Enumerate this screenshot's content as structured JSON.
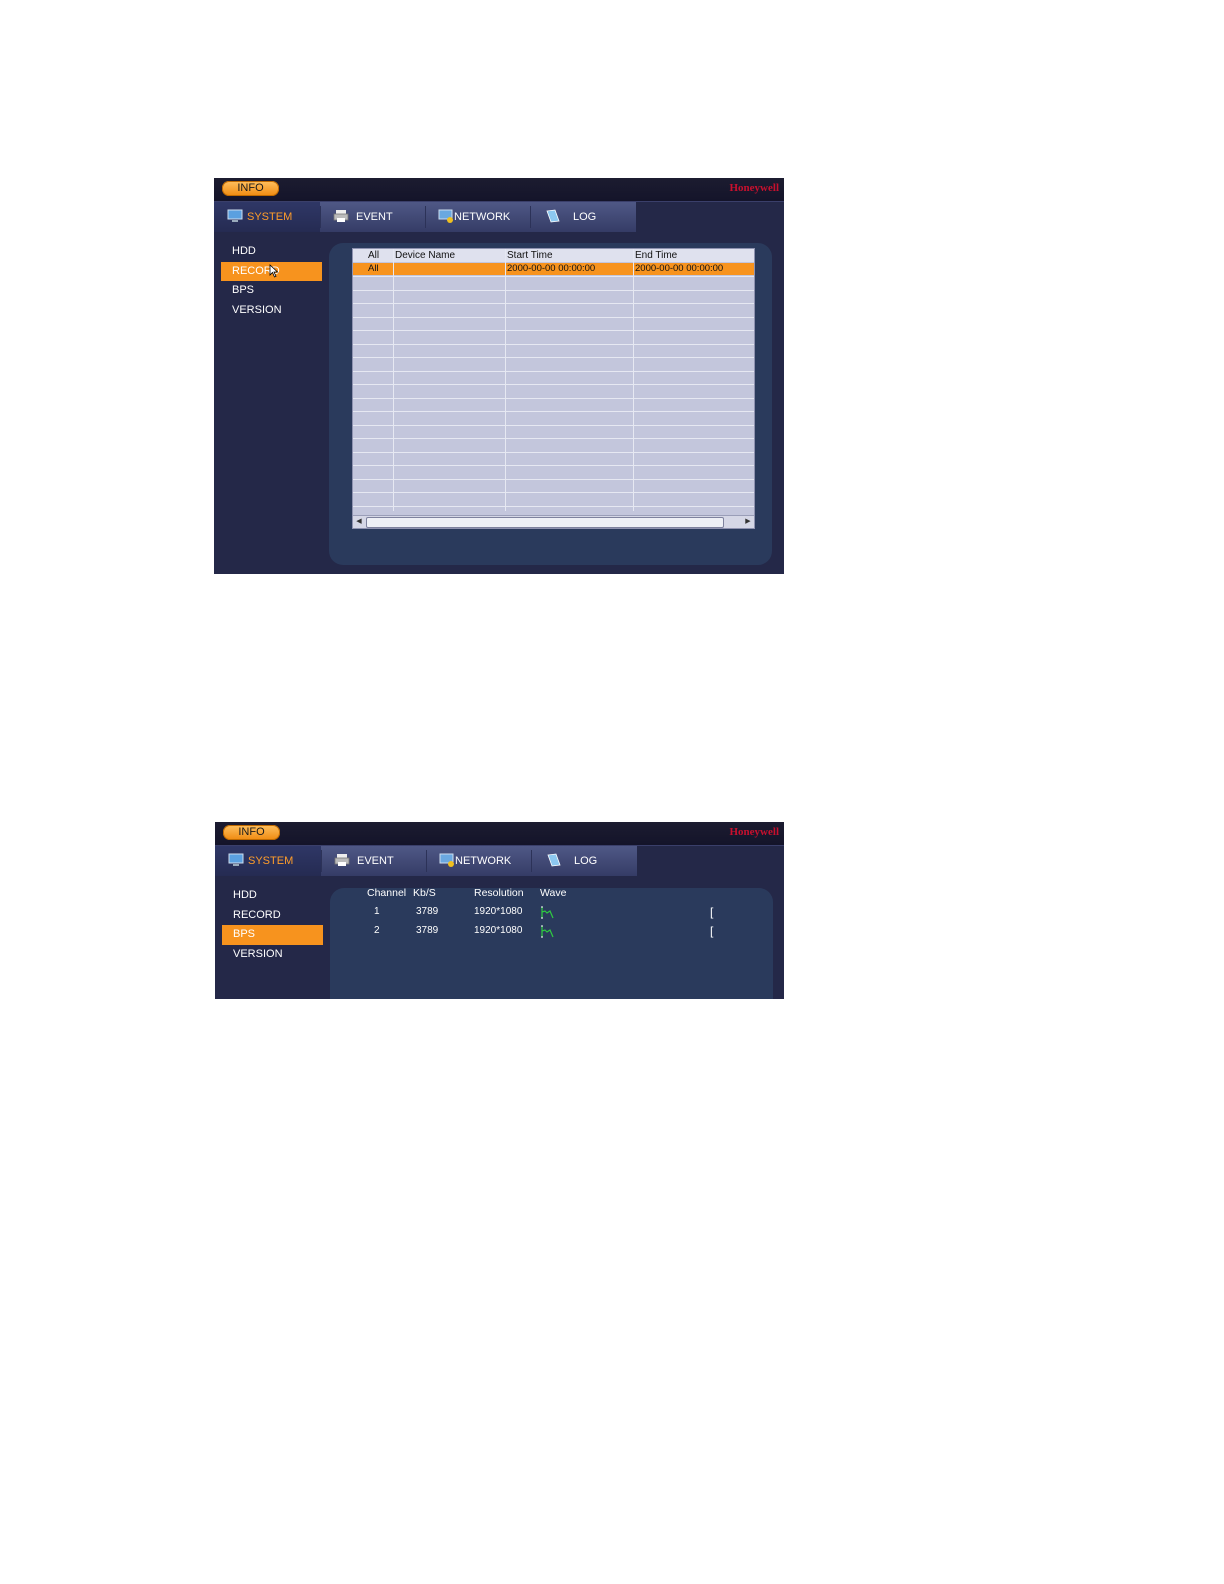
{
  "screens": [
    {
      "info_button": "INFO",
      "brand": "Honeywell",
      "tabs": [
        {
          "label": "SYSTEM",
          "icon": "system-monitor-icon",
          "active": true
        },
        {
          "label": "EVENT",
          "icon": "event-printer-icon",
          "active": false
        },
        {
          "label": "NETWORK",
          "icon": "network-monitor-icon",
          "active": false
        },
        {
          "label": "LOG",
          "icon": "log-book-icon",
          "active": false
        }
      ],
      "menu": [
        {
          "label": "HDD",
          "selected": false
        },
        {
          "label": "RECORD",
          "selected": true
        },
        {
          "label": "BPS",
          "selected": false
        },
        {
          "label": "VERSION",
          "selected": false
        }
      ],
      "record_table": {
        "columns": [
          "All",
          "Device Name",
          "Start Time",
          "End Time"
        ],
        "rows": [
          {
            "all": "All",
            "device_name": "",
            "start_time": "2000-00-00 00:00:00",
            "end_time": "2000-00-00 00:00:00",
            "selected": true
          }
        ]
      }
    },
    {
      "info_button": "INFO",
      "brand": "Honeywell",
      "tabs": [
        {
          "label": "SYSTEM",
          "icon": "system-monitor-icon",
          "active": true
        },
        {
          "label": "EVENT",
          "icon": "event-printer-icon",
          "active": false
        },
        {
          "label": "NETWORK",
          "icon": "network-monitor-icon",
          "active": false
        },
        {
          "label": "LOG",
          "icon": "log-book-icon",
          "active": false
        }
      ],
      "menu": [
        {
          "label": "HDD",
          "selected": false
        },
        {
          "label": "RECORD",
          "selected": false
        },
        {
          "label": "BPS",
          "selected": true
        },
        {
          "label": "VERSION",
          "selected": false
        }
      ],
      "bps_table": {
        "columns": [
          "Channel",
          "Kb/S",
          "Resolution",
          "Wave"
        ],
        "rows": [
          {
            "channel": "1",
            "kbps": "3789",
            "resolution": "1920*1080"
          },
          {
            "channel": "2",
            "kbps": "3789",
            "resolution": "1920*1080"
          }
        ]
      }
    }
  ],
  "colors": {
    "background": "#242848",
    "accent": "#f7931e",
    "brand_red": "#c8102e",
    "table_bg": "#c3c6dc",
    "wave_green": "#2ecc40"
  }
}
